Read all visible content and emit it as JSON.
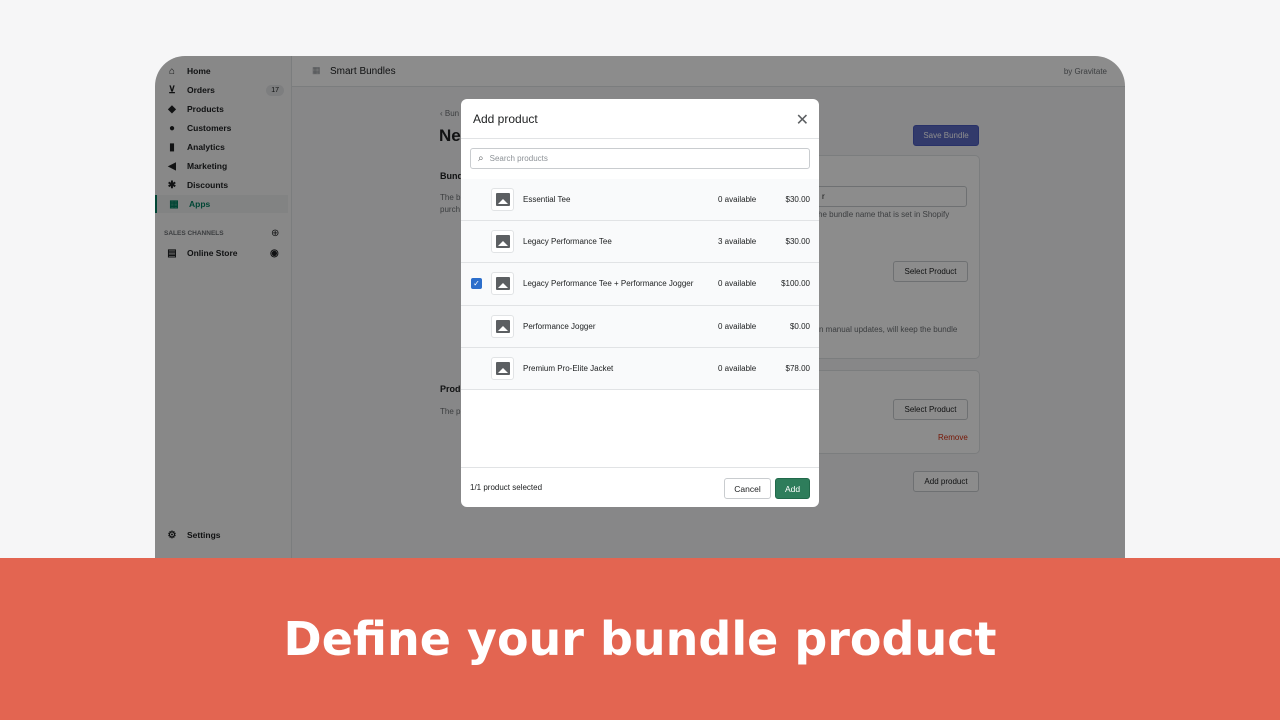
{
  "sidebar": {
    "items": [
      {
        "label": "Home",
        "icon": "home-icon",
        "glyph": "⌂"
      },
      {
        "label": "Orders",
        "icon": "orders-icon",
        "glyph": "⊻",
        "badge": "17"
      },
      {
        "label": "Products",
        "icon": "tag-icon",
        "glyph": "◆"
      },
      {
        "label": "Customers",
        "icon": "person-icon",
        "glyph": "●"
      },
      {
        "label": "Analytics",
        "icon": "bar-chart-icon",
        "glyph": "▮"
      },
      {
        "label": "Marketing",
        "icon": "megaphone-icon",
        "glyph": "◀"
      },
      {
        "label": "Discounts",
        "icon": "discount-icon",
        "glyph": "✱"
      },
      {
        "label": "Apps",
        "icon": "apps-icon",
        "glyph": "▦"
      }
    ],
    "sales_channels_label": "SALES CHANNELS",
    "online_store": "Online Store",
    "settings": "Settings"
  },
  "topbar": {
    "app_name": "Smart Bundles",
    "by": "by Gravitate"
  },
  "page": {
    "back": "Bun",
    "title": "Ne",
    "section1": "Bund",
    "desc1a": "The b",
    "desc1b": "purch",
    "section2": "Prod",
    "desc2": "The p",
    "save": "Save Bundle",
    "input_fragment": "r",
    "helper": "he bundle name that is set in Shopify",
    "select_product": "Select Product",
    "manual_text": "n manual updates, will keep the bundle",
    "remove": "Remove",
    "add_product": "Add product"
  },
  "modal": {
    "title": "Add product",
    "search_placeholder": "Search products",
    "products": [
      {
        "name": "Essential Tee",
        "available": "0 available",
        "price": "$30.00",
        "checked": false
      },
      {
        "name": "Legacy Performance Tee",
        "available": "3 available",
        "price": "$30.00",
        "checked": false
      },
      {
        "name": "Legacy Performance Tee + Performance Jogger",
        "available": "0 available",
        "price": "$100.00",
        "checked": true
      },
      {
        "name": "Performance Jogger",
        "available": "0 available",
        "price": "$0.00",
        "checked": false
      },
      {
        "name": "Premium Pro-Elite Jacket",
        "available": "0 available",
        "price": "$78.00",
        "checked": false
      }
    ],
    "selected_count": "1/1 product selected",
    "cancel": "Cancel",
    "add": "Add"
  },
  "banner": "Define your bundle product",
  "colors": {
    "banner": "#e36551",
    "primary": "#008060",
    "save": "#5c6ac4",
    "checkbox": "#2c6ecb"
  }
}
